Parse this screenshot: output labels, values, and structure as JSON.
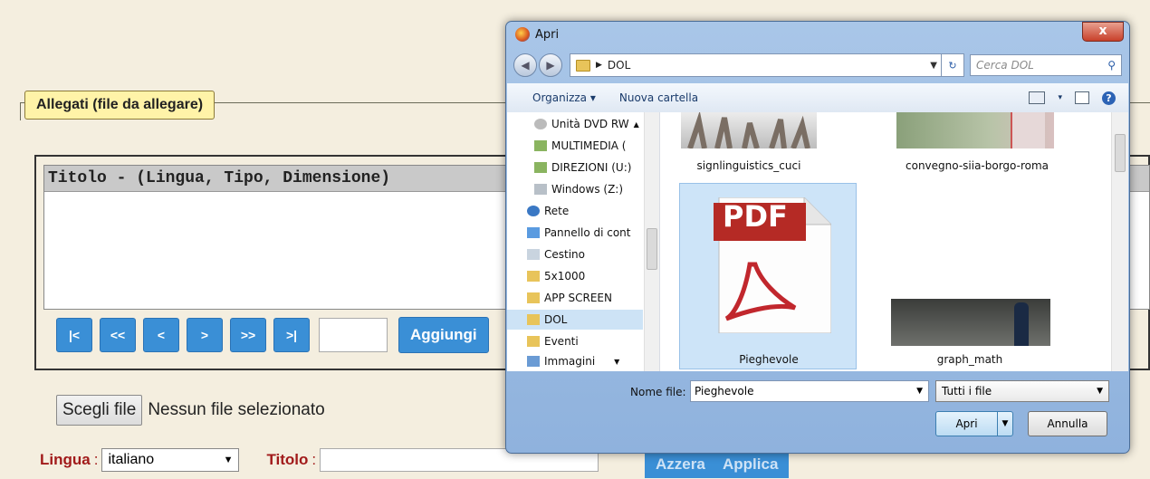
{
  "page": {
    "top_cut_text": "Allegati (file da allegare)",
    "legend": "Allegati (file da allegare)",
    "list_header": "Titolo - (Lingua, Tipo, Dimensione)",
    "nav": {
      "first": "|<",
      "prev_page": "<<",
      "prev": "<",
      "next": ">",
      "next_page": ">>",
      "last": ">|"
    },
    "add_label": "Aggiungi",
    "choose_file_label": "Scegli file",
    "no_file_text": "Nessun file selezionato",
    "lingua_label": "Lingua",
    "lingua_value": "italiano",
    "titolo_label": "Titolo",
    "reset_label": "Azzera",
    "apply_label": "Applica"
  },
  "dialog": {
    "title": "Apri",
    "close": "x",
    "path": "DOL",
    "search_placeholder": "Cerca DOL",
    "toolbar": {
      "organize": "Organizza",
      "new_folder": "Nuova cartella"
    },
    "nav_items": [
      "Unità DVD RW",
      "MULTIMEDIA (",
      "DIREZIONI (U:)",
      "Windows (Z:)",
      "Rete",
      "Pannello di cont",
      "Cestino",
      "5x1000",
      "APP SCREEN",
      "DOL",
      "Eventi",
      "Immagini"
    ],
    "files": [
      "signlinguistics_cuci",
      "convegno-siia-borgo-roma",
      "Pieghevole",
      "graph_math"
    ],
    "pdf_text": "PDF",
    "file_name_label": "Nome file:",
    "file_name_value": "Pieghevole",
    "file_type": "Tutti i file",
    "open_label": "Apri",
    "cancel_label": "Annulla"
  },
  "colors": {
    "accent": "#3a8fd6",
    "legend_bg": "#fff3a8",
    "label_red": "#a11a1a"
  }
}
